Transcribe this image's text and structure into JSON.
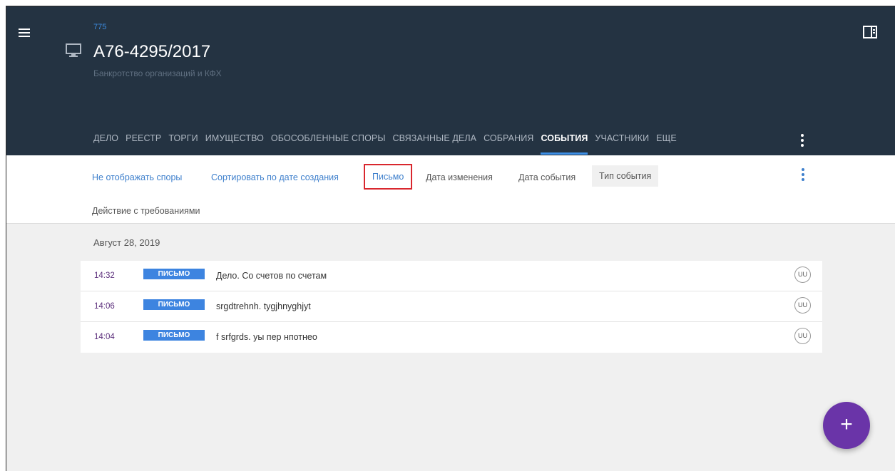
{
  "header": {
    "case_number": "775",
    "title": "А76-4295/2017",
    "subtitle": "Банкротство организаций и КФХ"
  },
  "tabs": [
    {
      "label": "ДЕЛО"
    },
    {
      "label": "РЕЕСТР"
    },
    {
      "label": "ТОРГИ"
    },
    {
      "label": "ИМУЩЕСТВО"
    },
    {
      "label": "ОБОСОБЛЕННЫЕ СПОРЫ"
    },
    {
      "label": "СВЯЗАННЫЕ ДЕЛА"
    },
    {
      "label": "СОБРАНИЯ"
    },
    {
      "label": "СОБЫТИЯ",
      "active": true
    },
    {
      "label": "УЧАСТНИКИ"
    },
    {
      "label": "ЕЩЕ"
    }
  ],
  "toolbar": {
    "hide_disputes": "Не отображать споры",
    "sort_by_created": "Сортировать по дате создания",
    "letter": "Письмо",
    "date_changed": "Дата изменения",
    "date_event": "Дата события",
    "event_type": "Тип события",
    "claims_action": "Действие с требованиями"
  },
  "events": {
    "date": "Август 28, 2019",
    "items": [
      {
        "time": "14:32",
        "type": "ПИСЬМО",
        "text": "Дело. Со счетов по счетам",
        "avatar": "UU"
      },
      {
        "time": "14:06",
        "type": "ПИСЬМО",
        "text": "srgdtrehnh. tygjhnyghjyt",
        "avatar": "UU"
      },
      {
        "time": "14:04",
        "type": "ПИСЬМО",
        "text": "f srfgrds. уы пер нпотнео",
        "avatar": "UU"
      }
    ]
  },
  "fab": {
    "label": "+"
  },
  "colors": {
    "header_bg": "#243342",
    "accent": "#3d8fe6",
    "badge": "#3d84e0",
    "fab": "#6a34a8",
    "highlight": "#d9272e"
  }
}
